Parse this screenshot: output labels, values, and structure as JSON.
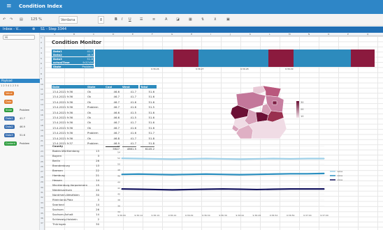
{
  "window": {
    "title": "Condition Index"
  },
  "toolbar": {
    "font": "Verdana",
    "font_size": "8",
    "zoom": "125 %"
  },
  "tabs": {
    "left": "Inbox - V...",
    "sheet": "S1 - Step 3344"
  },
  "sidebar": {
    "top_button": "Hi",
    "payload_header": "Payload",
    "payload_counts": "1 2 3 4 1 2 3 4",
    "items": [
      {
        "label": "Value",
        "color": "#e07b2e"
      },
      {
        "label": "Data",
        "color": "#e07b2e"
      },
      {
        "label": "State",
        "tag": "Problem",
        "color": "#2e9d3f"
      },
      {
        "label": "Data1",
        "tag": "41.7",
        "color": "#3a6fb0"
      },
      {
        "label": "Data2",
        "tag": "46.9",
        "color": "#3a6fb0"
      },
      {
        "label": "Data3",
        "tag": "51.6",
        "color": "#3a6fb0"
      },
      {
        "label": "Content",
        "tag": "Problem",
        "color": "#2e9d3f"
      }
    ]
  },
  "sheet": {
    "title": "Condition Monitor",
    "info_rows": [
      {
        "label": "Data1",
        "value": "41.7"
      },
      {
        "label": "Data2",
        "value": "46.9"
      },
      {
        "label": "Data3",
        "value": "51.8"
      },
      {
        "label": "actualTime",
        "value": "9:37:00"
      },
      {
        "label": "State",
        "value": "Problem"
      }
    ],
    "timeline_labels": [
      "9:36:26",
      "9:36:27",
      "9:36:28",
      "9:36:29"
    ],
    "columns": [
      "Date",
      "State",
      "Cool",
      "West",
      "Total"
    ],
    "table_rows": [
      [
        "13.4.2021 9:36",
        "Ok",
        "46.6",
        "41.7",
        "51.6"
      ],
      [
        "13.4.2021 9:36",
        "Ok",
        "46.7",
        "41.7",
        "51.6"
      ],
      [
        "13.4.2021 9:36",
        "Ok",
        "46.7",
        "41.6",
        "51.6"
      ],
      [
        "13.4.2021 9:36",
        "Problem",
        "46.7",
        "41.6",
        "51.5"
      ],
      [
        "13.4.2021 9:36",
        "Ok",
        "46.6",
        "41.5",
        "51.6"
      ],
      [
        "13.4.2021 9:36",
        "Ok",
        "46.6",
        "41.5",
        "51.6"
      ],
      [
        "13.4.2021 9:36",
        "Ok",
        "46.7",
        "41.7",
        "51.6"
      ],
      [
        "13.4.2021 9:36",
        "Ok",
        "46.7",
        "41.6",
        "51.6"
      ],
      [
        "13.4.2021 9:36",
        "Problem",
        "46.7",
        "41.6",
        "51.7"
      ],
      [
        "13.4.2021 9:36",
        "Ok",
        "46.8",
        "41.7",
        "51.8"
      ],
      [
        "13.4.2021 9:37",
        "Problem",
        "46.9",
        "41.7",
        "51.8"
      ]
    ],
    "totals": [
      "5947",
      "4981.5",
      "6145.2"
    ],
    "county_header": "County",
    "counties": [
      [
        "Baden-Württemberg",
        "13"
      ],
      [
        "Bayern",
        "3"
      ],
      [
        "Berlin",
        "26"
      ],
      [
        "Brandenburg",
        "13"
      ],
      [
        "Bremen",
        "22"
      ],
      [
        "Hamburg",
        "21"
      ],
      [
        "Hessen",
        "14"
      ],
      [
        "Mecklenburg-Vorpommern",
        "15"
      ],
      [
        "Niedersachsen",
        "20"
      ],
      [
        "Nordrhein-Westfalen",
        "30"
      ],
      [
        "Rheinland-Pfalz",
        "3"
      ],
      [
        "Saarland",
        "14"
      ],
      [
        "Sachsen",
        "26"
      ],
      [
        "Sachsen-Anhalt",
        "14"
      ],
      [
        "Schleswig-Holstein",
        "2"
      ],
      [
        "Thüringen",
        "30"
      ]
    ],
    "map_legend": [
      "30",
      "20",
      "10"
    ]
  },
  "chart_data": {
    "type": "line",
    "x": [
      "9:36:09",
      "9:36:14",
      "9:36:19",
      "9:36:24",
      "9:36:29",
      "9:36:34",
      "9:36:39",
      "9:36:44",
      "9:36:49",
      "9:36:54",
      "9:36:59",
      "9:37:04",
      "9:37:09"
    ],
    "series": [
      {
        "name": "value",
        "color": "#9ed0e8",
        "values": [
          52.0,
          51.9,
          51.8,
          51.7,
          51.8,
          51.9,
          51.8,
          51.7,
          51.8,
          51.9,
          51.8,
          51.9,
          51.9
        ]
      },
      {
        "name": "value",
        "color": "#2a8fc0",
        "values": [
          46.6,
          46.7,
          46.6,
          46.5,
          46.6,
          46.7,
          46.6,
          46.5,
          46.6,
          46.7,
          46.8,
          46.8,
          46.9
        ]
      },
      {
        "name": "value",
        "color": "#151560",
        "values": [
          41.7,
          41.6,
          41.5,
          41.4,
          41.5,
          41.6,
          41.7,
          41.6,
          41.5,
          41.6,
          41.7,
          41.7,
          41.7
        ]
      }
    ],
    "ylim": [
      34,
      56
    ],
    "yticks": [
      "56",
      "54",
      "52",
      "50",
      "48",
      "46",
      "44",
      "42",
      "40",
      "38",
      "36",
      "34"
    ],
    "legend_position": "right"
  }
}
